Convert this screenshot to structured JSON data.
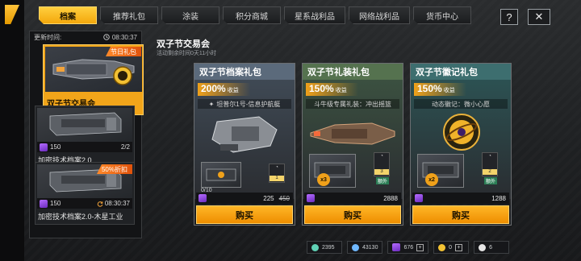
{
  "tabs": [
    {
      "label": "档案",
      "active": true
    },
    {
      "label": "推荐礼包",
      "active": false
    },
    {
      "label": "涂装",
      "active": false
    },
    {
      "label": "积分商城",
      "active": false
    },
    {
      "label": "星系战利品",
      "active": false
    },
    {
      "label": "网络战利品",
      "active": false
    },
    {
      "label": "货币中心",
      "active": false
    }
  ],
  "top_buttons": {
    "help_label": "?",
    "close_label": "✕"
  },
  "left_panel": {
    "update_label": "更新时间:",
    "update_time": "08:30:37",
    "selected_card": {
      "ribbon": "节日礼包",
      "label": "双子节交易会"
    },
    "cards": [
      {
        "cost": "150",
        "count": "2/2",
        "label": "加密技术档案2.0"
      },
      {
        "ribbon": "50%折扣",
        "cost": "150",
        "timer": "08:30:37",
        "label": "加密技术档案2.0-木星工业"
      }
    ]
  },
  "main": {
    "title": "双子节交易会",
    "subtitle": "活动剩余时间0天11小时"
  },
  "packs": [
    {
      "title": "双子节档案礼包",
      "pct": "200%",
      "pct_suffix": "收益",
      "desc": "坦普尔1号-信息护航艇",
      "progress": "0/10",
      "badge_count": "1",
      "price": "225",
      "old_price": "450",
      "buy": "购买",
      "head_color": "#5b6a7b",
      "body_color": "#3f4954"
    },
    {
      "title": "双子节礼装礼包",
      "pct": "150%",
      "pct_suffix": "收益",
      "desc": "斗牛级专属礼装：冲出摇篮",
      "badge_count": "3",
      "badge_tag": "额外",
      "multiplier": "x3",
      "price": "2888",
      "buy": "购买",
      "head_color": "#55724f",
      "body_color": "#3b5040"
    },
    {
      "title": "双子节徽记礼包",
      "pct": "150%",
      "pct_suffix": "收益",
      "desc": "动态徽记：微小心愿",
      "badge_count": "2",
      "badge_tag": "额外",
      "multiplier": "x2",
      "price": "1288",
      "buy": "购买",
      "head_color": "#3d6e6f",
      "body_color": "#2c5152"
    }
  ],
  "currencies": [
    {
      "value": "2395",
      "color": "#5fd1b5"
    },
    {
      "value": "43130",
      "color": "#6fb8ff"
    },
    {
      "value": "676",
      "color": "#b56cff"
    },
    {
      "value": "0",
      "color": "#f3c233"
    },
    {
      "value": "6",
      "color": "#e6e6e6"
    }
  ]
}
